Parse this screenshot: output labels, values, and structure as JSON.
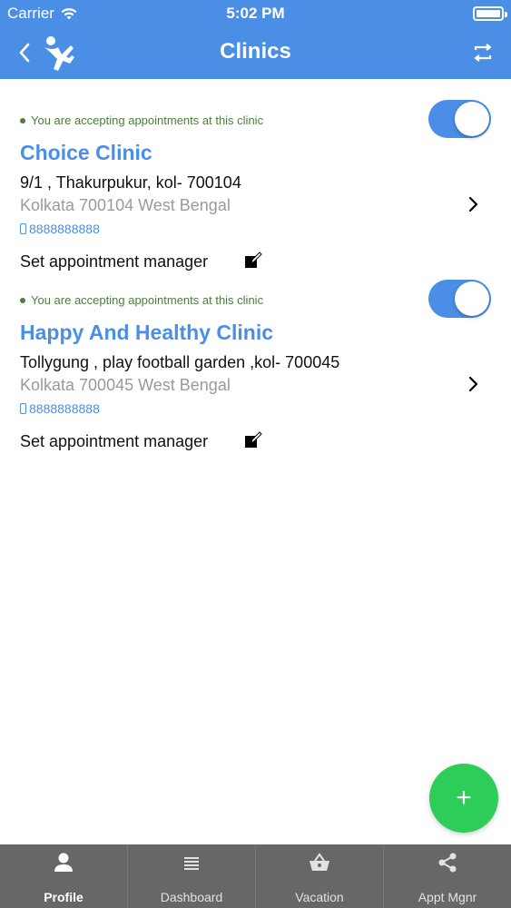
{
  "status_bar": {
    "carrier": "Carrier",
    "time": "5:02 PM"
  },
  "header": {
    "title": "Clinics",
    "back_icon": "chevron-left-icon",
    "logo_icon": "figure-logo-icon",
    "switch_icon": "swap-arrows-icon"
  },
  "clinics": [
    {
      "status": "You are accepting appointments at this clinic",
      "name": "Choice Clinic",
      "address": "9/1 , Thakurpukur, kol- 700104",
      "city": "Kolkata 700104 West Bengal",
      "phone": "8888888888",
      "manager_label": "Set appointment manager",
      "toggle_on": true
    },
    {
      "status": "You are accepting appointments at this clinic",
      "name": "Happy And Healthy Clinic",
      "address": "Tollygung , play football garden ,kol- 700045",
      "city": "Kolkata 700045 West Bengal",
      "phone": "8888888888",
      "manager_label": "Set appointment manager",
      "toggle_on": true
    }
  ],
  "fab": {
    "label": "+"
  },
  "tabs": [
    {
      "label": "Profile",
      "icon": "person-icon",
      "active": true
    },
    {
      "label": "Dashboard",
      "icon": "list-icon",
      "active": false
    },
    {
      "label": "Vacation",
      "icon": "basket-icon",
      "active": false
    },
    {
      "label": "Appt Mgnr",
      "icon": "share-icon",
      "active": false
    }
  ],
  "colors": {
    "primary": "#4a8ee6",
    "status_green": "#4c7d3c",
    "fab_green": "#2ecc59",
    "tab_bar": "#676767"
  }
}
